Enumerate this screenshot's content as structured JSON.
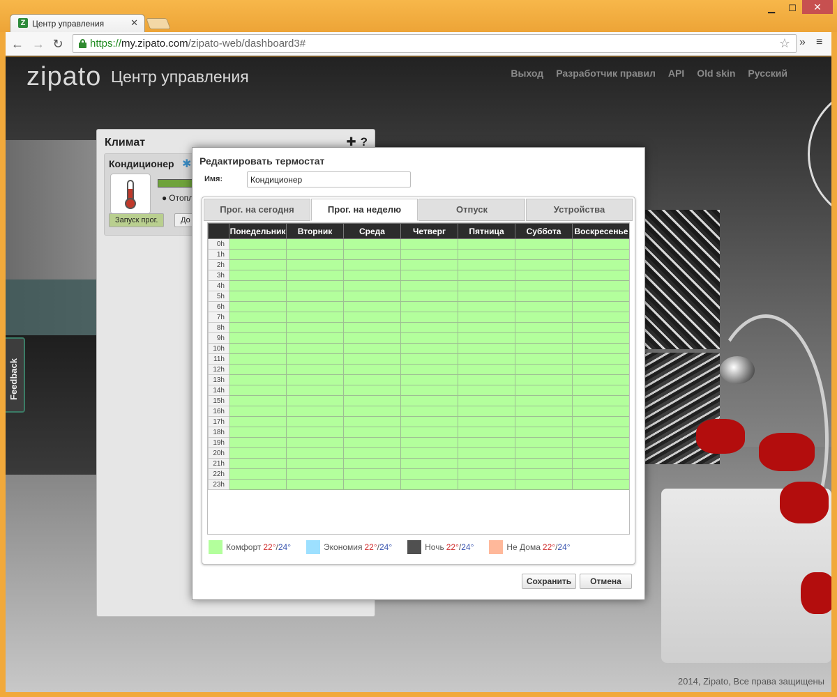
{
  "browser": {
    "tab_title": "Центр управления",
    "url_scheme": "https://",
    "url_host": "my.zipato.com",
    "url_path": "/zipato-web/dashboard3#"
  },
  "header": {
    "brand": "zipato",
    "subtitle": "Центр управления",
    "links": [
      "Выход",
      "Разработчик правил",
      "API",
      "Old skin",
      "Русский"
    ]
  },
  "feedback": "Feedback",
  "widget": {
    "title": "Климат",
    "device_name": "Кондиционер",
    "mode_label": "Отопл",
    "run_program_label": "Запуск прог.",
    "second_btn_label": "До"
  },
  "dialog": {
    "title": "Редактировать термостат",
    "name_label": "Имя:",
    "name_value": "Кондиционер",
    "tabs": [
      "Прог. на сегодня",
      "Прог. на неделю",
      "Отпуск",
      "Устройства"
    ],
    "active_tab": 1,
    "days": [
      "Понедельник",
      "Вторник",
      "Среда",
      "Четверг",
      "Пятница",
      "Суббота",
      "Воскресенье"
    ],
    "hours": [
      "0h",
      "1h",
      "2h",
      "3h",
      "4h",
      "5h",
      "6h",
      "7h",
      "8h",
      "9h",
      "10h",
      "11h",
      "12h",
      "13h",
      "14h",
      "15h",
      "16h",
      "17h",
      "18h",
      "19h",
      "20h",
      "21h",
      "22h",
      "23h"
    ],
    "cell_mode": "Комфорт",
    "legend": [
      {
        "name": "Комфорт",
        "heat": "22°",
        "cool": "24°",
        "color": "#b3ff9c"
      },
      {
        "name": "Экономия",
        "heat": "22°",
        "cool": "24°",
        "color": "#9de0ff"
      },
      {
        "name": "Ночь",
        "heat": "22°",
        "cool": "24°",
        "color": "#505050"
      },
      {
        "name": "Не Дома",
        "heat": "22°",
        "cool": "24°",
        "color": "#ffb89a"
      }
    ],
    "save_label": "Сохранить",
    "cancel_label": "Отмена"
  },
  "footer": "2014, Zipato, Все права защищены"
}
